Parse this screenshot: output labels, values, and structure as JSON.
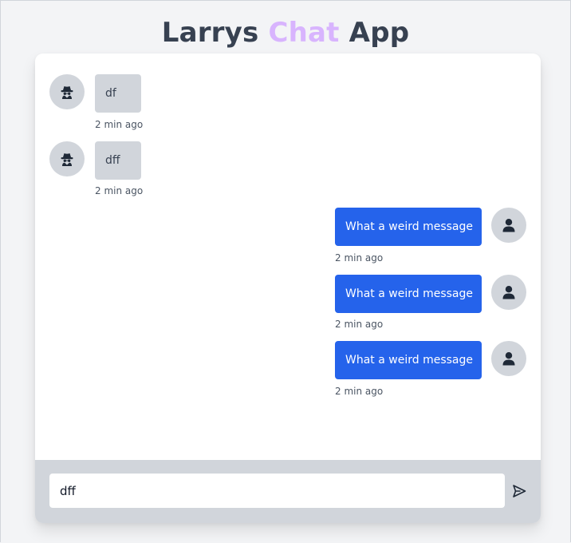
{
  "header": {
    "title_part1": "Larrys ",
    "title_accent": "Chat",
    "title_part2": " App",
    "accent_color": "#d8b4fe"
  },
  "messages": [
    {
      "direction": "incoming",
      "text": "df",
      "time": "2 min ago",
      "avatar_icon": "spy-icon"
    },
    {
      "direction": "incoming",
      "text": "dff",
      "time": "2 min ago",
      "avatar_icon": "spy-icon"
    },
    {
      "direction": "outgoing",
      "text": "What a weird message",
      "time": "2 min ago",
      "avatar_icon": "user-icon"
    },
    {
      "direction": "outgoing",
      "text": "What a weird message",
      "time": "2 min ago",
      "avatar_icon": "user-icon"
    },
    {
      "direction": "outgoing",
      "text": "What a weird message",
      "time": "2 min ago",
      "avatar_icon": "user-icon"
    }
  ],
  "composer": {
    "input_value": "dff",
    "send_icon": "send-icon"
  },
  "colors": {
    "outgoing_bubble": "#2563eb",
    "incoming_bubble": "#d1d5db",
    "background": "#f3f4f6"
  }
}
